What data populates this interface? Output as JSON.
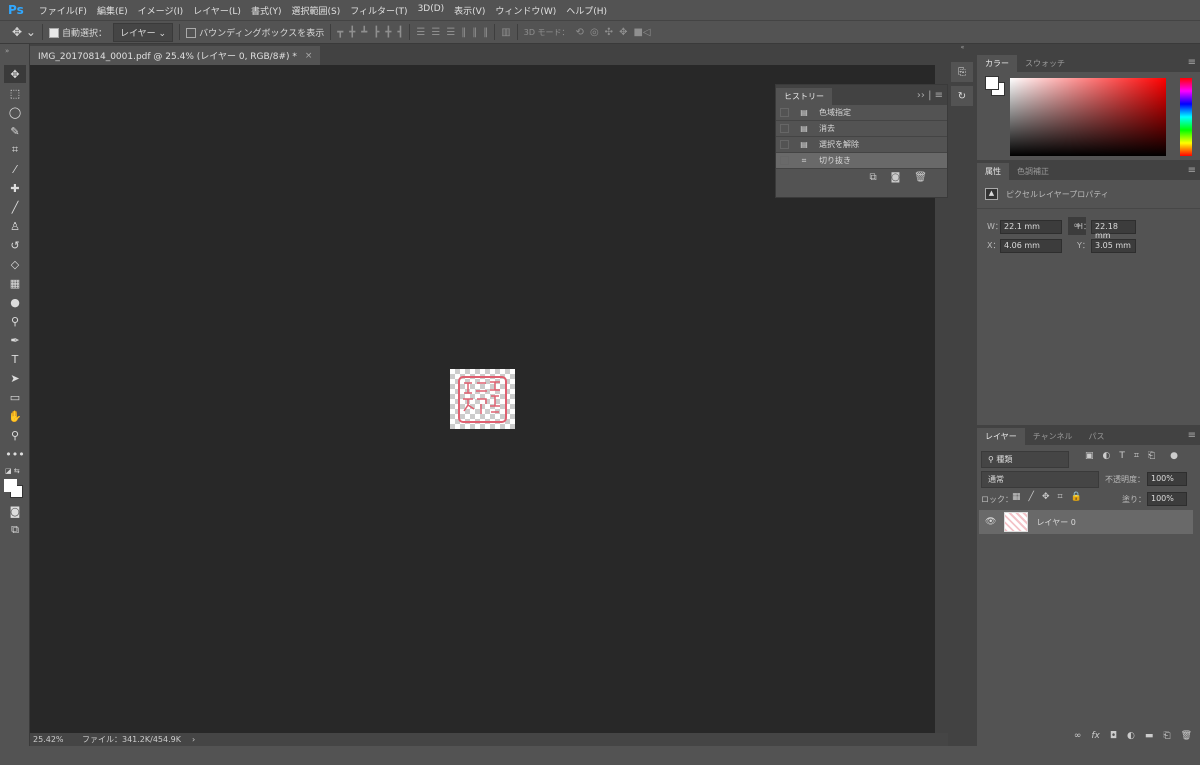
{
  "app": {
    "logo": "Ps"
  },
  "menu": [
    "ファイル(F)",
    "編集(E)",
    "イメージ(I)",
    "レイヤー(L)",
    "書式(Y)",
    "選択範囲(S)",
    "フィルター(T)",
    "3D(D)",
    "表示(V)",
    "ウィンドウ(W)",
    "ヘルプ(H)"
  ],
  "options": {
    "auto_select_label": "自動選択：",
    "auto_select_checked": true,
    "auto_select_target": "レイヤー",
    "bounding_box_label": "バウンディングボックスを表示",
    "bounding_box_checked": false,
    "mode_3d_label": "3D モード："
  },
  "document": {
    "tab_title": "IMG_20170814_0001.pdf @ 25.4% (レイヤー 0, RGB/8#) *",
    "close": "×"
  },
  "status": {
    "zoom": "25.42%",
    "file": "ファイル：341.2K/454.9K",
    "arrow": "›"
  },
  "history": {
    "tab": "ヒストリー",
    "items": [
      {
        "label": "色域指定",
        "icon": "document-icon"
      },
      {
        "label": "消去",
        "icon": "document-icon"
      },
      {
        "label": "選択を解除",
        "icon": "document-icon"
      },
      {
        "label": "切り抜き",
        "icon": "crop-icon",
        "active": true
      }
    ]
  },
  "color_panel": {
    "tabs": [
      "カラー",
      "スウォッチ"
    ],
    "foreground": "#ffffff",
    "background": "#ffffff",
    "hue": "#ff0000"
  },
  "properties": {
    "tabs": [
      "属性",
      "色調補正"
    ],
    "title": "ピクセルレイヤープロパティ",
    "w_label": "W：",
    "w": "22.1 mm",
    "h_label": "H：",
    "h": "22.18 mm",
    "x_label": "X：",
    "x": "4.06 mm",
    "y_label": "Y：",
    "y": "3.05 mm"
  },
  "layers": {
    "tabs": [
      "レイヤー",
      "チャンネル",
      "パス"
    ],
    "filter": "種類",
    "blend_mode": "通常",
    "opacity_label": "不透明度：",
    "opacity": "100%",
    "lock_label": "ロック：",
    "fill_label": "塗り：",
    "fill": "100%",
    "items": [
      {
        "name": "レイヤー 0",
        "visible": true
      }
    ]
  }
}
